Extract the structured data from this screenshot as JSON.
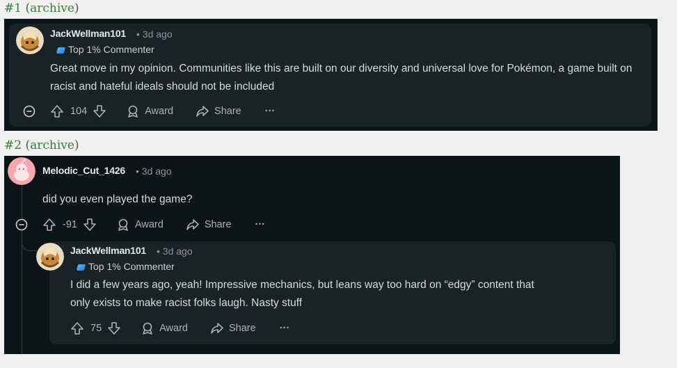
{
  "items": [
    {
      "number": "#1",
      "archive_text": "archive",
      "comment": {
        "username": "JackWellman101",
        "time": "3d ago",
        "badge": "Top 1% Commenter",
        "text": "Great move in my opinion. Communities like this are built on our diversity and universal love for Pokémon, a game built on racist and hateful ideals should not be included",
        "score": "104",
        "award_label": "Award",
        "share_label": "Share",
        "more_label": "···"
      }
    },
    {
      "number": "#2",
      "archive_text": "archive",
      "comment": {
        "username": "Melodic_Cut_1426",
        "time": "3d ago",
        "text": "did you even played the game?",
        "score": "-91",
        "award_label": "Award",
        "share_label": "Share",
        "more_label": "···"
      },
      "reply": {
        "username": "JackWellman101",
        "time": "3d ago",
        "badge": "Top 1% Commenter",
        "text_line1": "I did a few years ago, yeah! Impressive mechanics, but leans way too hard on “edgy” content that",
        "text_line2": "only exists to make racist folks laugh. Nasty stuff",
        "score": "75",
        "award_label": "Award",
        "share_label": "Share",
        "more_label": "···"
      }
    }
  ],
  "colors": {
    "page_bg": "#f0f0f0",
    "shot_bg": "#0b1416",
    "card_bg": "#1b2226",
    "link_green": "#3a7d3a",
    "text_primary": "#d7dadc",
    "text_meta": "#8a9499"
  }
}
